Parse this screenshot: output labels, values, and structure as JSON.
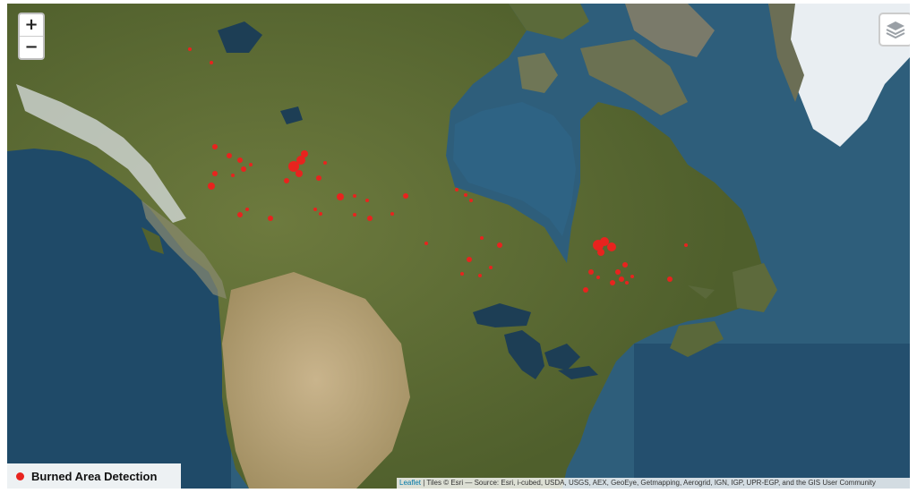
{
  "map": {
    "base_layer": "satellite imagery",
    "detection_color": "#e8231e"
  },
  "controls": {
    "zoom_in": "+",
    "zoom_out": "−",
    "layers_icon": "layers-icon"
  },
  "legend": {
    "label": "Burned Area Detection",
    "color": "#e8231e"
  },
  "attribution": {
    "leaflet": "Leaflet",
    "text": " | Tiles © Esri — Source: Esri, i-cubed, USDA, USGS, AEX, GeoEye, Getmapping, Aerogrid, IGN, IGP, UPR-EGP, and the GIS User Community"
  }
}
